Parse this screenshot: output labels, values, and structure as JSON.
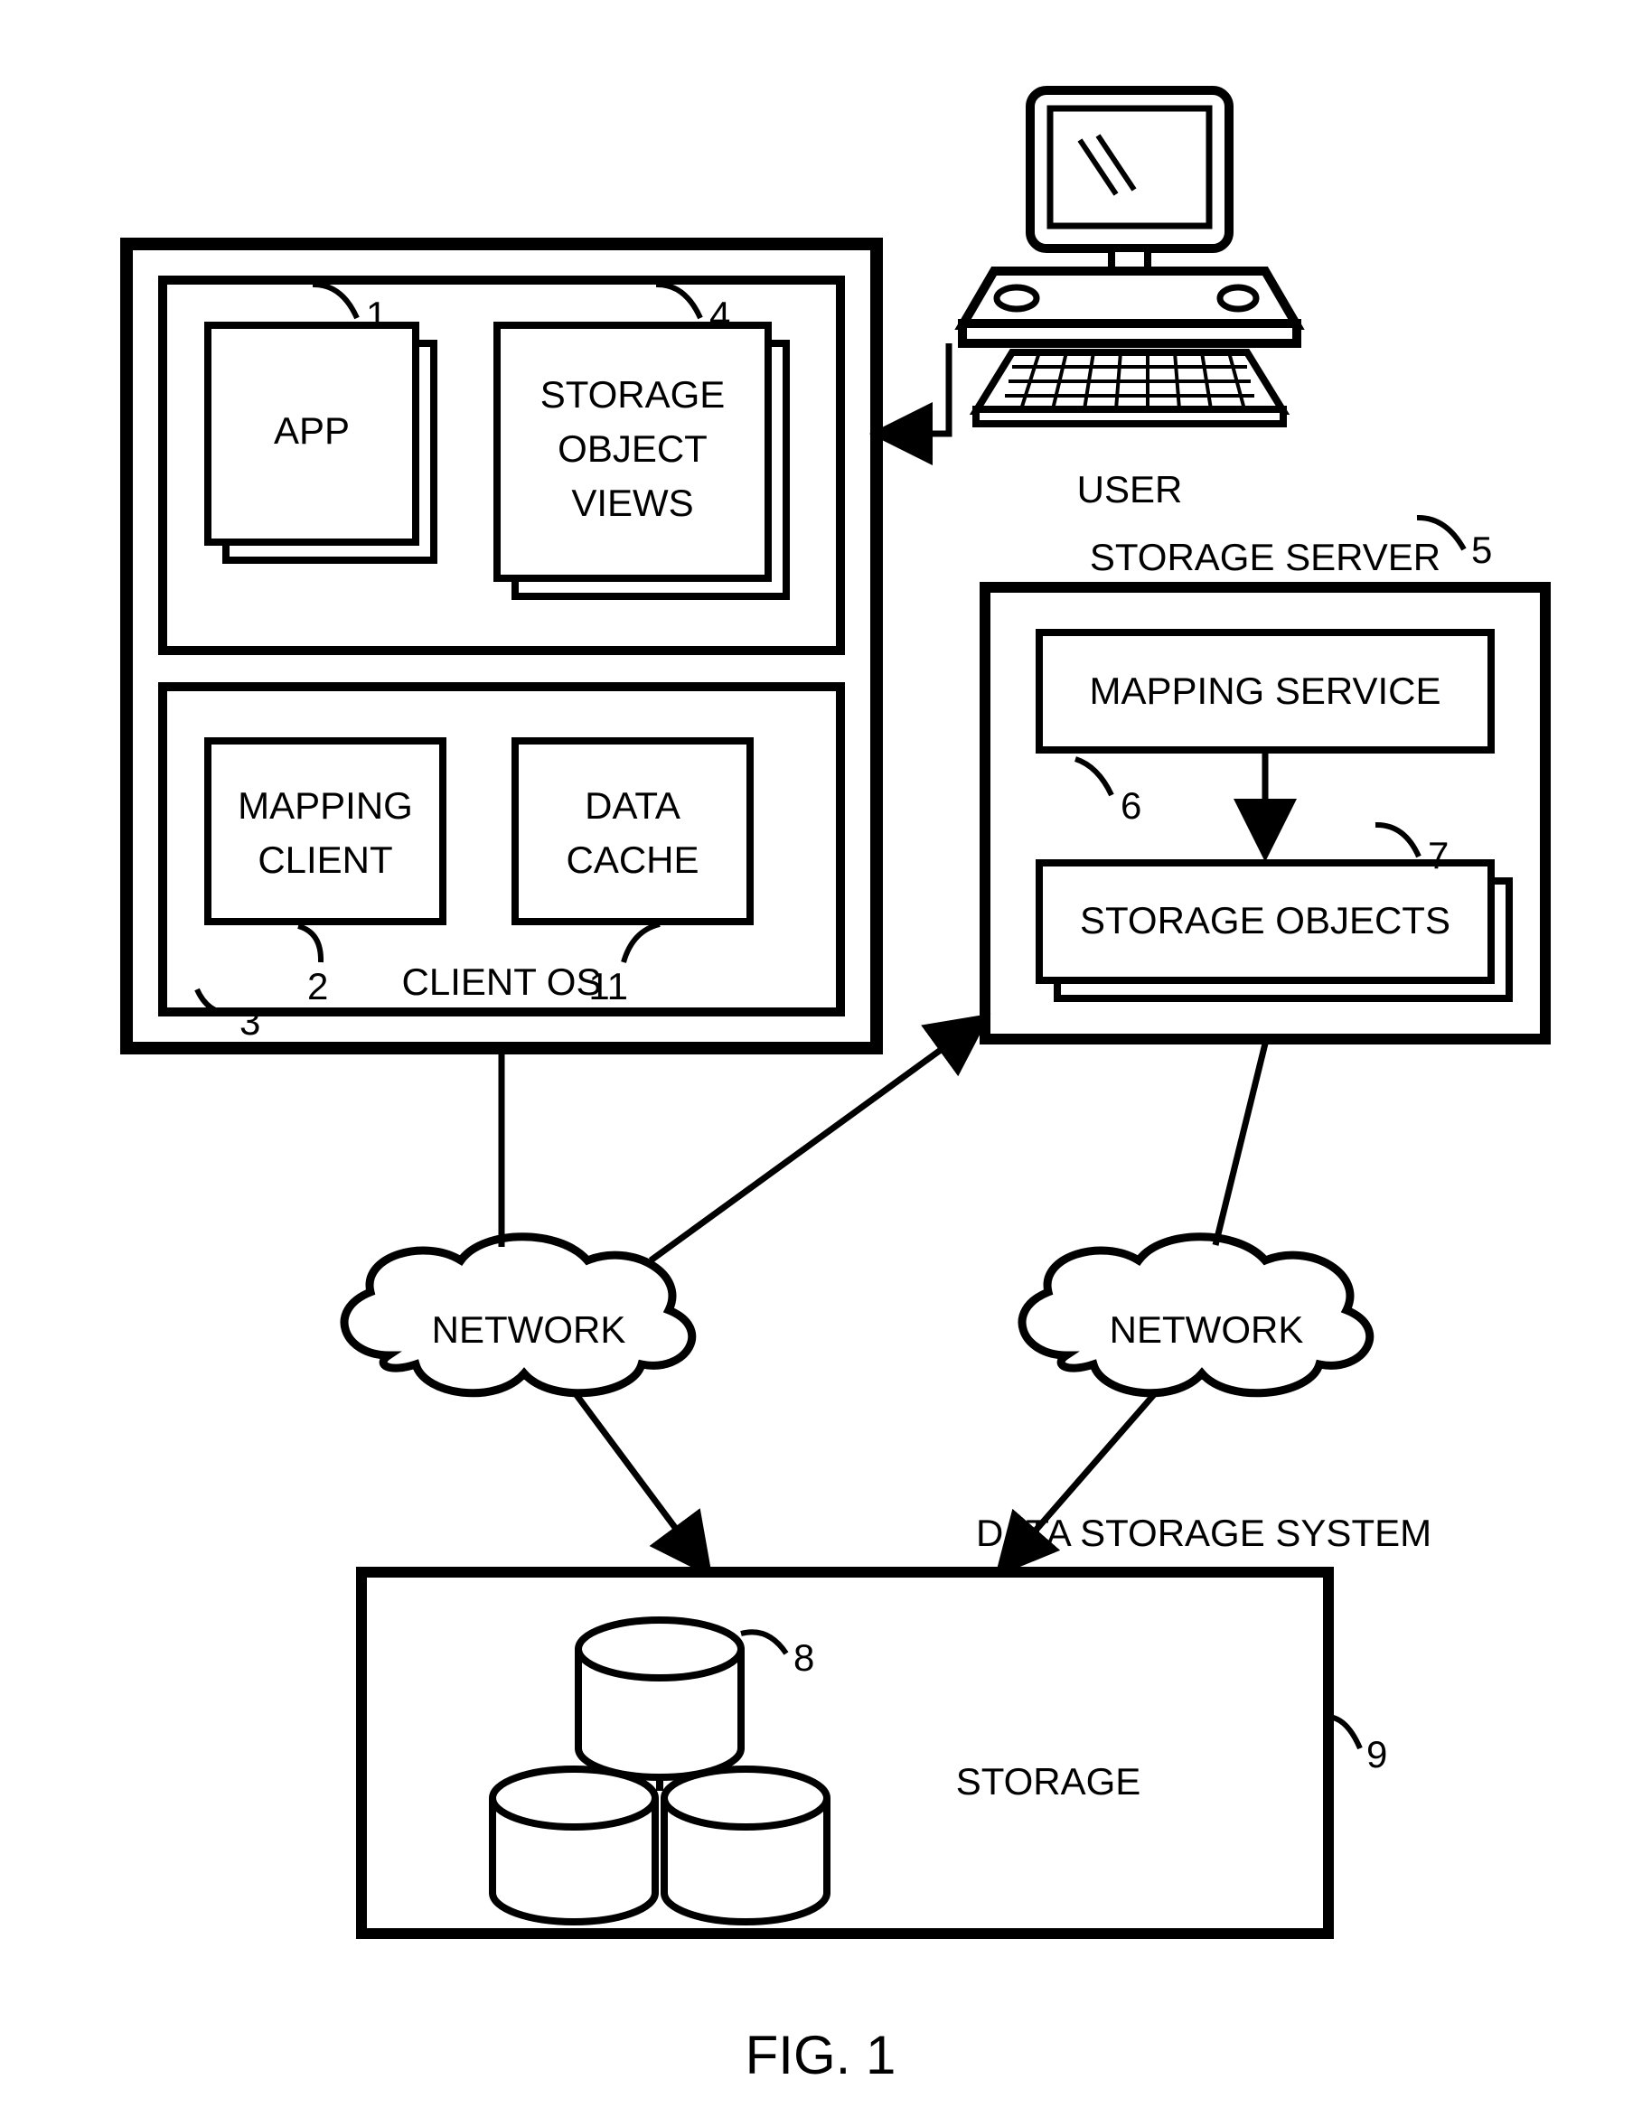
{
  "figure_caption": "FIG. 1",
  "labels": {
    "app": "APP",
    "storage_object_views_l1": "STORAGE",
    "storage_object_views_l2": "OBJECT",
    "storage_object_views_l3": "VIEWS",
    "mapping_client_l1": "MAPPING",
    "mapping_client_l2": "CLIENT",
    "data_cache_l1": "DATA",
    "data_cache_l2": "CACHE",
    "client_os": "CLIENT OS",
    "user": "USER",
    "storage_server": "STORAGE SERVER",
    "mapping_service": "MAPPING SERVICE",
    "storage_objects": "STORAGE OBJECTS",
    "network_left": "NETWORK",
    "network_right": "NETWORK",
    "data_storage_system": "DATA STORAGE SYSTEM",
    "storage": "STORAGE"
  },
  "refs": {
    "r1": "1",
    "r2": "2",
    "r3": "3",
    "r4": "4",
    "r5": "5",
    "r6": "6",
    "r7": "7",
    "r8": "8",
    "r9": "9",
    "r11": "11"
  }
}
